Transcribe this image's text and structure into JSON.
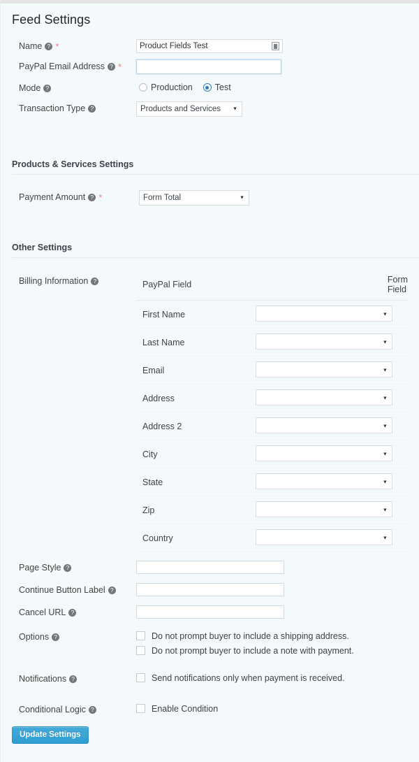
{
  "page": {
    "title": "Feed Settings"
  },
  "feed_settings": {
    "name": {
      "label": "Name",
      "help_icon": "question-mark-icon",
      "required_marker": "*",
      "value": "Product Fields Test",
      "autofill_icon": "autofill-save-icon"
    },
    "paypal_email": {
      "label": "PayPal Email Address",
      "help_icon": "question-mark-icon",
      "required_marker": "*",
      "value": "",
      "focused": true
    },
    "mode": {
      "label": "Mode",
      "help_icon": "question-mark-icon",
      "options": [
        {
          "label": "Production",
          "selected": false
        },
        {
          "label": "Test",
          "selected": true
        }
      ]
    },
    "transaction_type": {
      "label": "Transaction Type",
      "help_icon": "question-mark-icon",
      "value": "Products and Services",
      "caret_icon": "chevron-down-icon"
    }
  },
  "products_services": {
    "section_title": "Products & Services Settings",
    "payment_amount": {
      "label": "Payment Amount",
      "help_icon": "question-mark-icon",
      "required_marker": "*",
      "value": "Form Total",
      "caret_icon": "chevron-down-icon"
    }
  },
  "other_settings": {
    "section_title": "Other Settings",
    "billing_information": {
      "label": "Billing Information",
      "help_icon": "question-mark-icon",
      "columns": [
        "PayPal Field",
        "Form Field"
      ],
      "rows": [
        {
          "paypal_field": "First Name",
          "form_field": ""
        },
        {
          "paypal_field": "Last Name",
          "form_field": ""
        },
        {
          "paypal_field": "Email",
          "form_field": ""
        },
        {
          "paypal_field": "Address",
          "form_field": ""
        },
        {
          "paypal_field": "Address 2",
          "form_field": ""
        },
        {
          "paypal_field": "City",
          "form_field": ""
        },
        {
          "paypal_field": "State",
          "form_field": ""
        },
        {
          "paypal_field": "Zip",
          "form_field": ""
        },
        {
          "paypal_field": "Country",
          "form_field": ""
        }
      ]
    },
    "page_style": {
      "label": "Page Style",
      "help_icon": "question-mark-icon",
      "value": ""
    },
    "continue_button_label": {
      "label": "Continue Button Label",
      "help_icon": "question-mark-icon",
      "value": ""
    },
    "cancel_url": {
      "label": "Cancel URL",
      "help_icon": "question-mark-icon",
      "value": ""
    },
    "options": {
      "label": "Options",
      "help_icon": "question-mark-icon",
      "items": [
        {
          "label": "Do not prompt buyer to include a shipping address.",
          "checked": false
        },
        {
          "label": "Do not prompt buyer to include a note with payment.",
          "checked": false
        }
      ]
    },
    "notifications": {
      "label": "Notifications",
      "help_icon": "question-mark-icon",
      "items": [
        {
          "label": "Send notifications only when payment is received.",
          "checked": false
        }
      ]
    },
    "conditional_logic": {
      "label": "Conditional Logic",
      "help_icon": "question-mark-icon",
      "items": [
        {
          "label": "Enable Condition",
          "checked": false
        }
      ]
    }
  },
  "footer": {
    "update_button": "Update Settings"
  },
  "colors": {
    "background": "#f4f9fc",
    "accent_blue": "#3ba5d6",
    "required_red": "#f08784",
    "text": "#3c434a",
    "radio_selected": "#2b7cb9"
  }
}
